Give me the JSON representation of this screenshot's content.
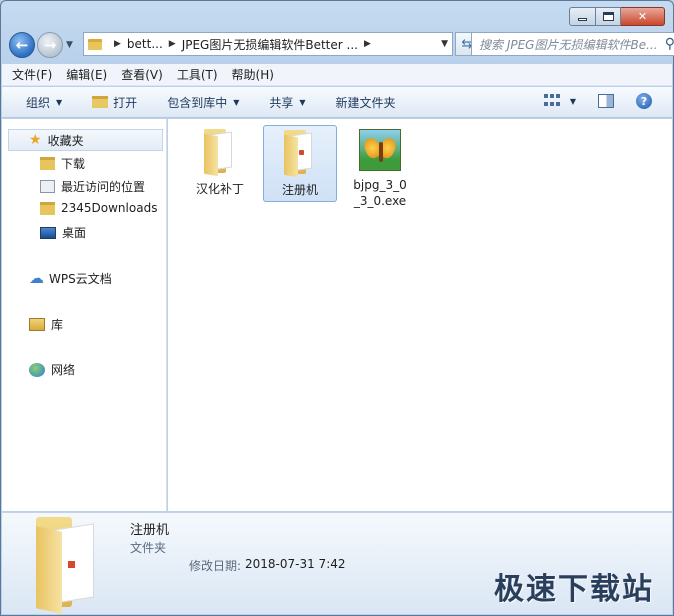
{
  "address": {
    "segments": [
      "bett...",
      "JPEG图片无损编辑软件Better ..."
    ]
  },
  "search": {
    "placeholder": "搜索 JPEG图片无损编辑软件Be..."
  },
  "menu": [
    "文件(F)",
    "编辑(E)",
    "查看(V)",
    "工具(T)",
    "帮助(H)"
  ],
  "toolbar": {
    "organize": "组织",
    "open": "打开",
    "include_library": "包含到库中",
    "share": "共享",
    "new_folder": "新建文件夹"
  },
  "navpane": {
    "favorites": "收藏夹",
    "downloads": "下载",
    "recent": "最近访问的位置",
    "downloads2345": "2345Downloads",
    "desktop": "桌面",
    "wps": "WPS云文档",
    "libraries": "库",
    "network": "网络"
  },
  "files": [
    {
      "name": "汉化补丁",
      "type": "folder"
    },
    {
      "name": "注册机",
      "type": "folder",
      "selected": true
    },
    {
      "name": "bjpg_3_0_3_0.exe",
      "type": "exe"
    }
  ],
  "details": {
    "name": "注册机",
    "type": "文件夹",
    "date_label": "修改日期:",
    "date_value": "2018-07-31 7:42"
  },
  "watermark": "极速下载站"
}
